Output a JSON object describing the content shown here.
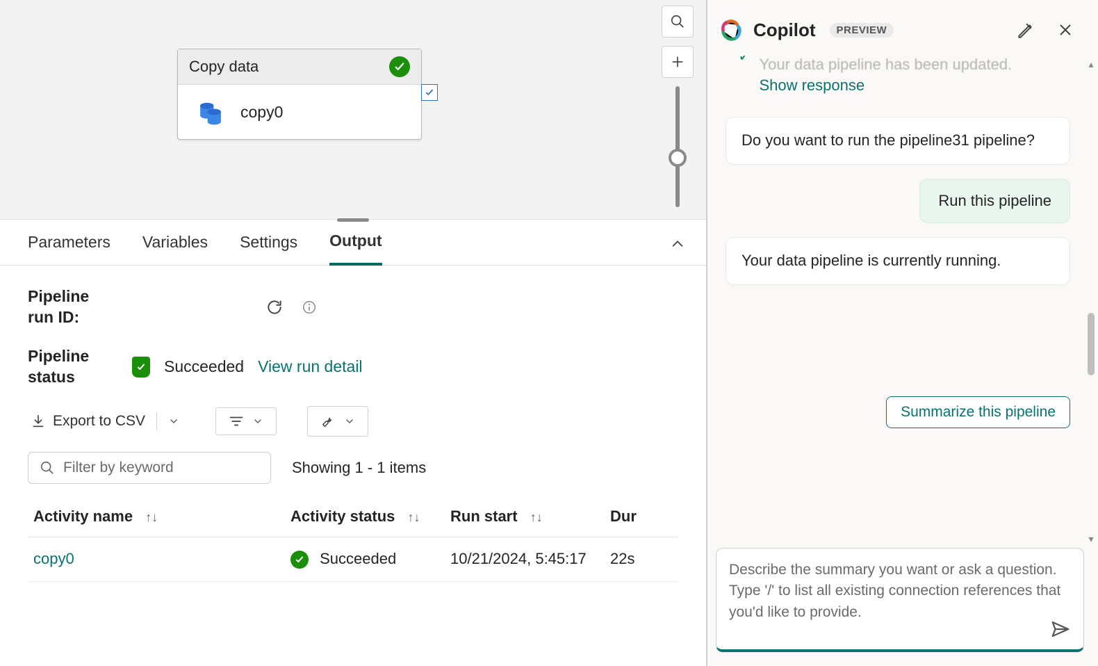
{
  "canvas": {
    "activity_title": "Copy data",
    "activity_name": "copy0"
  },
  "tabs": {
    "parameters": "Parameters",
    "variables": "Variables",
    "settings": "Settings",
    "output": "Output"
  },
  "output": {
    "run_id_label": "Pipeline run ID:",
    "status_label": "Pipeline status",
    "status_value": "Succeeded",
    "view_run_detail": "View run detail",
    "export_csv": "Export to CSV",
    "filter_placeholder": "Filter by keyword",
    "showing": "Showing 1 - 1 items",
    "columns": {
      "activity_name": "Activity name",
      "activity_status": "Activity status",
      "run_start": "Run start",
      "duration": "Dur"
    },
    "rows": [
      {
        "activity_name": "copy0",
        "activity_status": "Succeeded",
        "run_start": "10/21/2024, 5:45:17",
        "duration": "22s"
      }
    ]
  },
  "copilot": {
    "title": "Copilot",
    "badge": "PREVIEW",
    "truncated_text": "Your data pipeline has been updated.",
    "show_response": "Show response",
    "message_1": "Do you want to run the pipeline31 pipeline?",
    "user_message": "Run this pipeline",
    "message_2": "Your data pipeline is currently running.",
    "suggestion": "Summarize this pipeline",
    "input_placeholder": "Describe the summary you want or ask a question.\nType '/' to list all existing connection references that you'd like to provide."
  }
}
